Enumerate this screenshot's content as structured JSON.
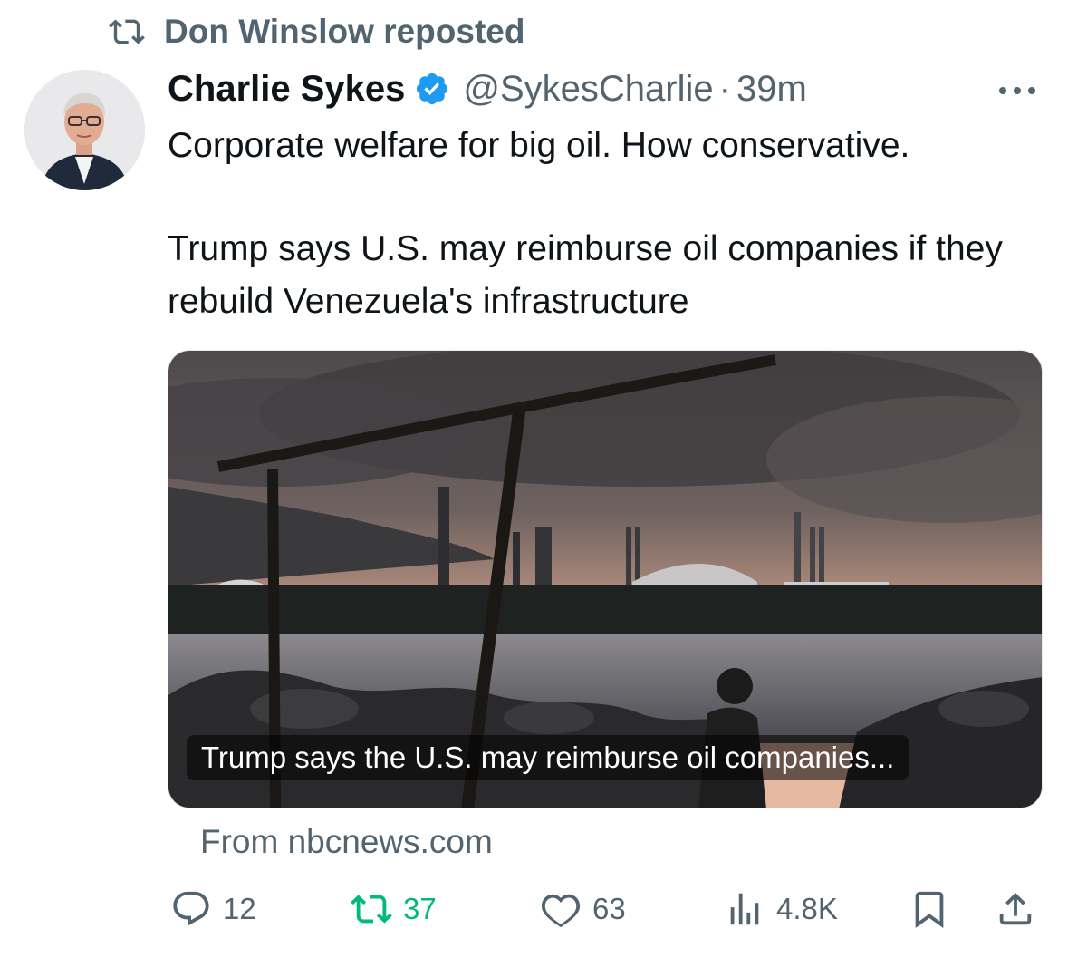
{
  "repost": {
    "label": "Don Winslow reposted",
    "icon": "repost-icon"
  },
  "author": {
    "name": "Charlie Sykes",
    "handle": "@SykesCharlie",
    "separator": "·",
    "time": "39m",
    "verified_icon": "verified-badge-icon"
  },
  "tweet": {
    "line1": "Corporate welfare for big oil. How conservative.",
    "line2": "Trump says U.S. may reimburse oil companies if they rebuild Venezuela's infrastructure"
  },
  "card": {
    "caption": "Trump says the U.S. may reimburse oil companies...",
    "source": "From nbcnews.com"
  },
  "actions": {
    "replies": "12",
    "reposts": "37",
    "likes": "63",
    "views": "4.8K"
  },
  "colors": {
    "text": "#0f1419",
    "secondary": "#536471",
    "verified": "#1d9bf0",
    "repost_active": "#00ba7c"
  }
}
